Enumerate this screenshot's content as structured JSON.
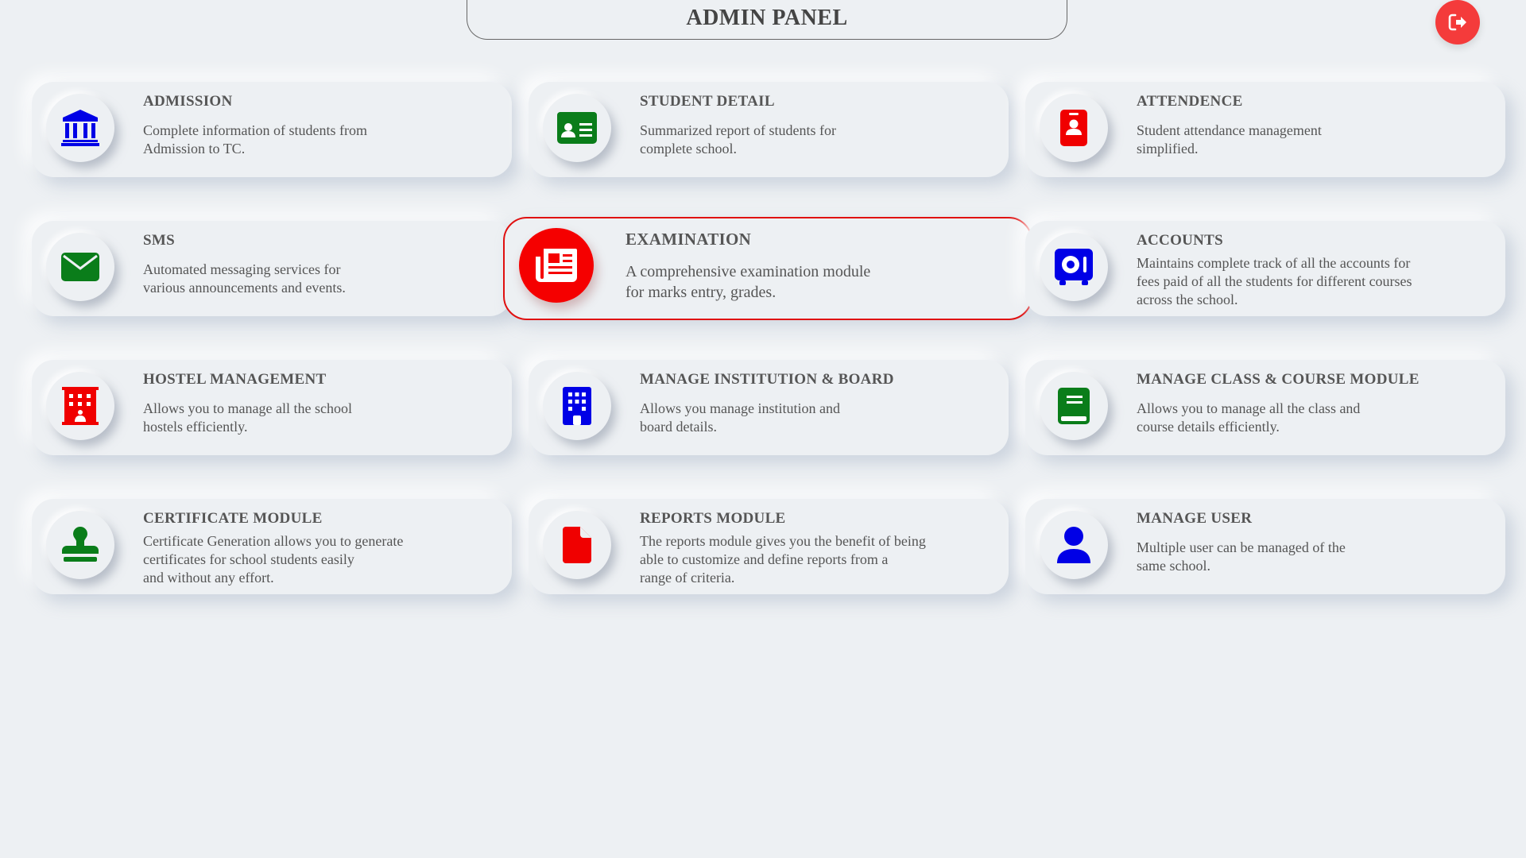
{
  "header": {
    "title": "ADMIN PANEL"
  },
  "logout": {
    "icon": "logout-icon",
    "color": "#f43b3b"
  },
  "cards": [
    {
      "title": "ADMISSION",
      "desc_lines": [
        "Complete information of students from",
        "Admission to TC."
      ],
      "icon": "bank-icon",
      "color": "#0000e6"
    },
    {
      "title": "STUDENT DETAIL",
      "desc_lines": [
        "Summarized report of students for",
        "complete school."
      ],
      "icon": "id-card-icon",
      "color": "#0a7d1a"
    },
    {
      "title": "ATTENDENCE",
      "desc_lines": [
        "Student attendance management",
        "simplified."
      ],
      "icon": "id-badge-icon",
      "color": "#f00000"
    },
    {
      "title": "SMS",
      "desc_lines": [
        "Automated messaging services for",
        "various announcements and events."
      ],
      "icon": "envelope-icon",
      "color": "#0a7d1a"
    },
    {
      "title": "EXAMINATION",
      "desc_lines": [
        "A comprehensive examination module",
        "for marks entry, grades."
      ],
      "icon": "newspaper-icon",
      "color": "#f50000",
      "active": true
    },
    {
      "title": "ACCOUNTS",
      "desc_lines": [
        "Maintains complete track of all the accounts for",
        "fees paid of all the students for different courses",
        "across the school."
      ],
      "icon": "safe-icon",
      "color": "#0000e6"
    },
    {
      "title": "HOSTEL MANAGEMENT",
      "desc_lines": [
        "Allows you to manage all the school",
        "hostels efficiently."
      ],
      "icon": "hotel-icon",
      "color": "#f00000"
    },
    {
      "title": "MANAGE INSTITUTION & BOARD",
      "desc_lines": [
        "Allows you manage institution and",
        "board details."
      ],
      "icon": "building-icon",
      "color": "#0000e6"
    },
    {
      "title": "MANAGE CLASS & COURSE MODULE",
      "desc_lines": [
        "Allows you to manage all the class and",
        "course details efficiently."
      ],
      "icon": "book-icon",
      "color": "#0a7d1a"
    },
    {
      "title": "CERTIFICATE MODULE",
      "desc_lines": [
        "Certificate Generation allows you to generate",
        "certificates for school students easily",
        "and without any effort."
      ],
      "icon": "stamp-icon",
      "color": "#0a7d1a"
    },
    {
      "title": "REPORTS MODULE",
      "desc_lines": [
        "The reports module gives you the benefit of being",
        "able to customize and define reports from a",
        "range of criteria."
      ],
      "icon": "file-icon",
      "color": "#f00000"
    },
    {
      "title": "MANAGE USER",
      "desc_lines": [
        "Multiple user can be managed of the",
        "same school."
      ],
      "icon": "user-icon",
      "color": "#0000e6"
    }
  ]
}
